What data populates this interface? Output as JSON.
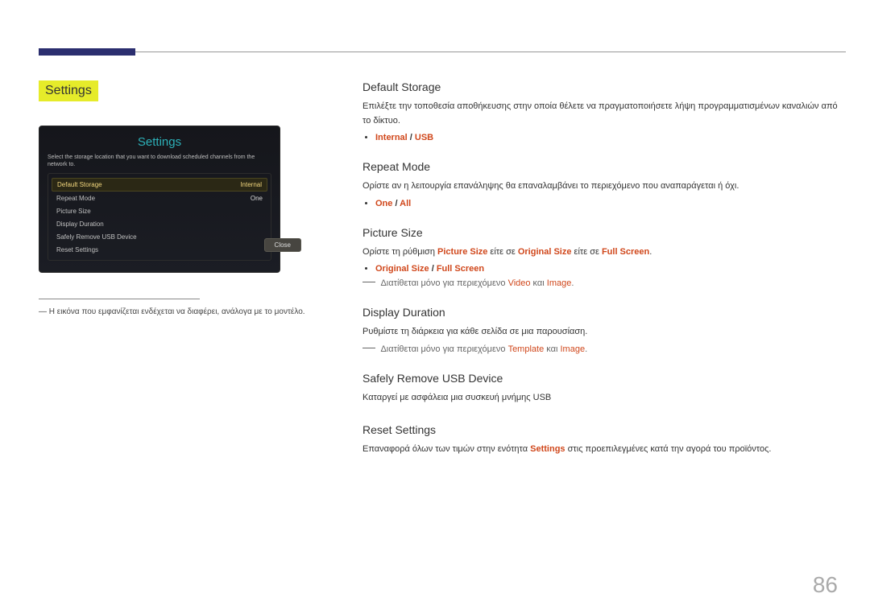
{
  "page_number": "86",
  "left": {
    "section_title": "Settings",
    "tv": {
      "title": "Settings",
      "desc": "Select the storage location that you want to download scheduled channels from the network to.",
      "rows": [
        {
          "label": "Default Storage",
          "value": "Internal",
          "selected": true
        },
        {
          "label": "Repeat Mode",
          "value": "One",
          "selected": false
        },
        {
          "label": "Picture Size",
          "value": "",
          "selected": false
        },
        {
          "label": "Display Duration",
          "value": "",
          "selected": false
        },
        {
          "label": "Safely Remove USB Device",
          "value": "",
          "selected": false
        },
        {
          "label": "Reset Settings",
          "value": "",
          "selected": false
        }
      ],
      "close_label": "Close"
    },
    "footnote_prefix": "―",
    "footnote": "Η εικόνα που εμφανίζεται ενδέχεται να διαφέρει, ανάλογα με το μοντέλο."
  },
  "sections": {
    "default_storage": {
      "title": "Default Storage",
      "desc": "Επιλέξτε την τοποθεσία αποθήκευσης στην οποία θέλετε να πραγματοποιήσετε λήψη προγραμματισμένων καναλιών από το δίκτυο.",
      "opt1": "Internal",
      "sep": " / ",
      "opt2": "USB"
    },
    "repeat_mode": {
      "title": "Repeat Mode",
      "desc": "Ορίστε αν η λειτουργία επανάληψης θα επαναλαμβάνει το περιεχόμενο που αναπαράγεται ή όχι.",
      "opt1": "One",
      "sep": " / ",
      "opt2": "All"
    },
    "picture_size": {
      "title": "Picture Size",
      "desc_pre": "Ορίστε τη ρύθμιση ",
      "desc_hl1": "Picture Size",
      "desc_mid1": " είτε σε ",
      "desc_hl2": "Original Size",
      "desc_mid2": " είτε σε ",
      "desc_hl3": "Full Screen",
      "desc_post": ".",
      "opt1": "Original Size",
      "sep": " / ",
      "opt2": "Full Screen",
      "note_pre": "Διατίθεται μόνο για περιεχόμενο ",
      "note_hl1": "Video",
      "note_mid": " και ",
      "note_hl2": "Image",
      "note_post": "."
    },
    "display_duration": {
      "title": "Display Duration",
      "desc": "Ρυθμίστε τη διάρκεια για κάθε σελίδα σε μια παρουσίαση.",
      "note_pre": "Διατίθεται μόνο για περιεχόμενο ",
      "note_hl1": "Template",
      "note_mid": " και ",
      "note_hl2": "Image",
      "note_post": "."
    },
    "safely_remove": {
      "title": "Safely Remove USB Device",
      "desc": "Καταργεί με ασφάλεια μια συσκευή μνήμης USB"
    },
    "reset": {
      "title": "Reset Settings",
      "desc_pre": "Επαναφορά όλων των τιμών στην ενότητα ",
      "desc_hl": "Settings",
      "desc_post": " στις προεπιλεγμένες κατά την αγορά του προϊόντος."
    }
  }
}
